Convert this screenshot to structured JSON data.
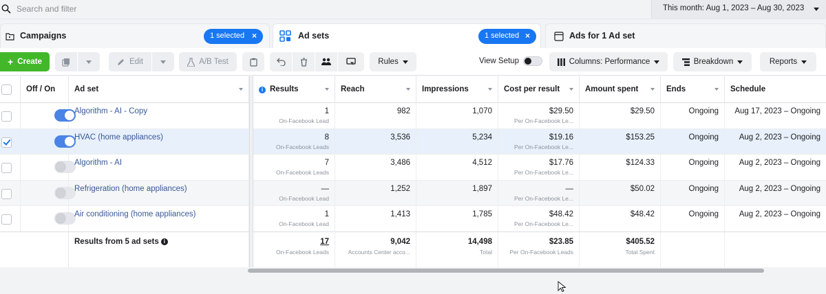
{
  "search": {
    "placeholder": "Search and filter"
  },
  "date_range": "This month: Aug 1, 2023 – Aug 30, 2023",
  "tabs": [
    {
      "label": "Campaigns",
      "pill": "1 selected"
    },
    {
      "label": "Ad sets",
      "pill": "1 selected"
    },
    {
      "label": "Ads for 1 Ad set"
    }
  ],
  "toolbar": {
    "create": "Create",
    "edit": "Edit",
    "ab_test": "A/B Test",
    "rules": "Rules",
    "view_setup": "View Setup",
    "columns": "Columns: Performance",
    "breakdown": "Breakdown",
    "reports": "Reports"
  },
  "columns": {
    "off_on": "Off / On",
    "ad_set": "Ad set",
    "results": "Results",
    "reach": "Reach",
    "impressions": "Impressions",
    "cost_per_result": "Cost per result",
    "amount_spent": "Amount spent",
    "ends": "Ends",
    "schedule": "Schedule"
  },
  "rows": [
    {
      "name": "Algorithm - AI - Copy",
      "on": true,
      "checked": false,
      "results": "1",
      "results_sub": "On-Facebook Lead",
      "reach": "982",
      "impressions": "1,070",
      "cpr": "$29.50",
      "cpr_sub": "Per On-Facebook Le...",
      "spent": "$29.50",
      "ends": "Ongoing",
      "schedule": "Aug 17, 2023 – Ongoing"
    },
    {
      "name": "HVAC (home appliances)",
      "on": true,
      "checked": true,
      "results": "8",
      "results_sub": "On-Facebook Leads",
      "reach": "3,536",
      "impressions": "5,234",
      "cpr": "$19.16",
      "cpr_sub": "Per On-Facebook Le...",
      "spent": "$153.25",
      "ends": "Ongoing",
      "schedule": "Aug 2, 2023 – Ongoing"
    },
    {
      "name": "Algorithm - AI",
      "on": false,
      "checked": false,
      "results": "7",
      "results_sub": "On-Facebook Leads",
      "reach": "3,486",
      "impressions": "4,512",
      "cpr": "$17.76",
      "cpr_sub": "Per On-Facebook Le...",
      "spent": "$124.33",
      "ends": "Ongoing",
      "schedule": "Aug 2, 2023 – Ongoing"
    },
    {
      "name": "Refrigeration (home appliances)",
      "on": false,
      "checked": false,
      "results": "—",
      "results_sub": "On-Facebook Lead",
      "reach": "1,252",
      "impressions": "1,897",
      "cpr": "—",
      "cpr_sub": "Per On-Facebook Le...",
      "spent": "$50.02",
      "ends": "Ongoing",
      "schedule": "Aug 2, 2023 – Ongoing"
    },
    {
      "name": "Air conditioning (home appliances)",
      "on": false,
      "checked": false,
      "results": "1",
      "results_sub": "On-Facebook Lead",
      "reach": "1,413",
      "impressions": "1,785",
      "cpr": "$48.42",
      "cpr_sub": "Per On-Facebook Le...",
      "spent": "$48.42",
      "ends": "Ongoing",
      "schedule": "Aug 2, 2023 – Ongoing"
    }
  ],
  "totals": {
    "label": "Results from 5 ad sets",
    "results": "17",
    "results_sub": "On-Facebook Leads",
    "reach": "9,042",
    "reach_sub": "Accounts Center acco...",
    "impressions": "14,498",
    "impressions_sub": "Total",
    "cpr": "$23.85",
    "cpr_sub": "Per On-Facebook Leads",
    "spent": "$405.52",
    "spent_sub": "Total Spent"
  },
  "colors": {
    "accent": "#1877f2",
    "create": "#42b72a",
    "link": "#385898"
  }
}
